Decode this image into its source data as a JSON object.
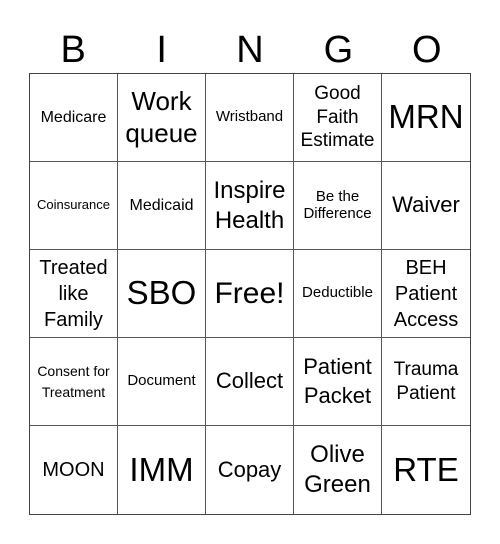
{
  "header": [
    "B",
    "I",
    "N",
    "G",
    "O"
  ],
  "cells": [
    "Medicare",
    "Work queue",
    "Wristband",
    "Good Faith Estimate",
    "MRN",
    "Coinsurance",
    "Medicaid",
    "Inspire Health",
    "Be the Difference",
    "Waiver",
    "Treated like Family",
    "SBO",
    "Free!",
    "Deductible",
    "BEH Patient Access",
    "Consent for Treatment",
    "Document",
    "Collect",
    "Patient Packet",
    "Trauma Patient",
    "MOON",
    "IMM",
    "Copay",
    "Olive Green",
    "RTE"
  ]
}
